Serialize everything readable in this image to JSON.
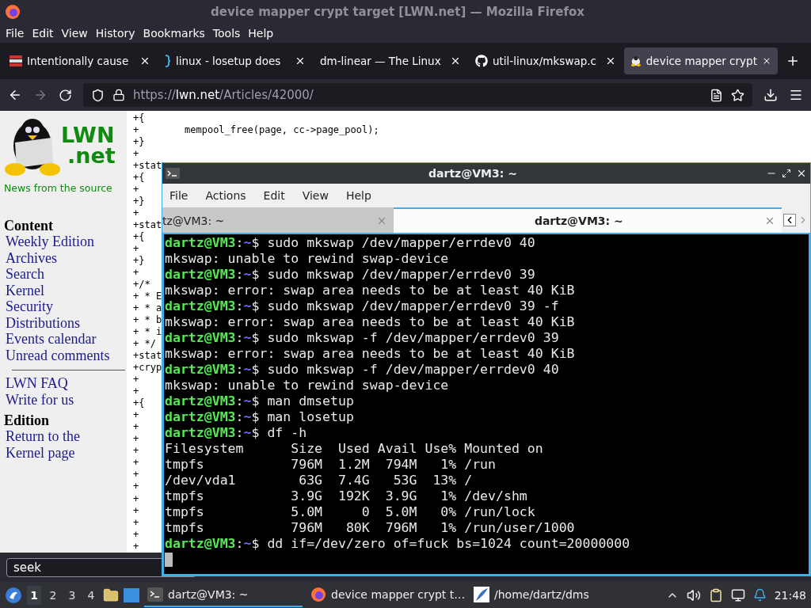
{
  "browser": {
    "title": "device mapper crypt target [LWN.net] — Mozilla Firefox",
    "menu": [
      "File",
      "Edit",
      "View",
      "History",
      "Bookmarks",
      "Tools",
      "Help"
    ],
    "tabs": [
      {
        "label": "Intentionally cause",
        "selected": false
      },
      {
        "label": "linux - losetup does",
        "selected": false
      },
      {
        "label": "dm-linear — The Linux",
        "selected": false
      },
      {
        "label": "util-linux/mkswap.c",
        "selected": false
      },
      {
        "label": "device mapper crypt",
        "selected": true
      }
    ],
    "url": {
      "scheme": "https://",
      "host": "lwn.net",
      "path": "/Articles/42000/"
    }
  },
  "sidebar": {
    "logo": {
      "line1": "LWN",
      "line2": ".net"
    },
    "tagline": "News from the source",
    "sections": [
      {
        "heading": "Content",
        "links": [
          "Weekly Edition",
          "Archives",
          "Search",
          "Kernel",
          "Security",
          "Distributions",
          "Events calendar",
          "Unread comments"
        ]
      },
      {
        "links": [
          "LWN FAQ",
          "Write for us"
        ]
      },
      {
        "heading": "Edition",
        "links": [
          "Return to the Kernel page"
        ]
      }
    ]
  },
  "code_lines": [
    "+{",
    "+        mempool_free(page, cc->page_pool);",
    "+}",
    "+",
    "+stat",
    "+{",
    "+",
    "+}",
    "+",
    "+stat",
    "+{",
    "+",
    "+}",
    "+",
    "+/*",
    "+ * E",
    "+ * a",
    "+ * b",
    "+ * i",
    "+ */",
    "+stat",
    "+cryp",
    "+",
    "+",
    "+{",
    "+",
    "+",
    "+",
    "+",
    "+",
    "+",
    "+",
    "+",
    "+",
    "+",
    "+",
    "+"
  ],
  "find_bar": {
    "value": "seek"
  },
  "terminal": {
    "title": "dartz@VM3: ~",
    "menu": [
      "File",
      "Actions",
      "Edit",
      "View",
      "Help"
    ],
    "tabs": [
      {
        "label": "tz@VM3: ~",
        "selected": false
      },
      {
        "label": "dartz@VM3: ~",
        "selected": true
      }
    ],
    "lines": [
      {
        "kind": "prompt",
        "user": "dartz@VM3",
        "colon": ":",
        "cwd": "~",
        "command": "$ sudo mkswap /dev/mapper/errdev0 40"
      },
      {
        "kind": "output",
        "text": "mkswap: unable to rewind swap-device"
      },
      {
        "kind": "prompt",
        "user": "dartz@VM3",
        "colon": ":",
        "cwd": "~",
        "command": "$ sudo mkswap /dev/mapper/errdev0 39"
      },
      {
        "kind": "output",
        "text": "mkswap: error: swap area needs to be at least 40 KiB"
      },
      {
        "kind": "prompt",
        "user": "dartz@VM3",
        "colon": ":",
        "cwd": "~",
        "command": "$ sudo mkswap /dev/mapper/errdev0 39 -f"
      },
      {
        "kind": "output",
        "text": "mkswap: error: swap area needs to be at least 40 KiB"
      },
      {
        "kind": "prompt",
        "user": "dartz@VM3",
        "colon": ":",
        "cwd": "~",
        "command": "$ sudo mkswap -f /dev/mapper/errdev0 39"
      },
      {
        "kind": "output",
        "text": "mkswap: error: swap area needs to be at least 40 KiB"
      },
      {
        "kind": "prompt",
        "user": "dartz@VM3",
        "colon": ":",
        "cwd": "~",
        "command": "$ sudo mkswap -f /dev/mapper/errdev0 40"
      },
      {
        "kind": "output",
        "text": "mkswap: unable to rewind swap-device"
      },
      {
        "kind": "prompt",
        "user": "dartz@VM3",
        "colon": ":",
        "cwd": "~",
        "command": "$ man dmsetup"
      },
      {
        "kind": "prompt",
        "user": "dartz@VM3",
        "colon": ":",
        "cwd": "~",
        "command": "$ man losetup"
      },
      {
        "kind": "prompt",
        "user": "dartz@VM3",
        "colon": ":",
        "cwd": "~",
        "command": "$ df -h"
      },
      {
        "kind": "output",
        "text": "Filesystem      Size  Used Avail Use% Mounted on"
      },
      {
        "kind": "output",
        "text": "tmpfs           796M  1.2M  794M   1% /run"
      },
      {
        "kind": "output",
        "text": "/dev/vda1        63G  7.4G   53G  13% /"
      },
      {
        "kind": "output",
        "text": "tmpfs           3.9G  192K  3.9G   1% /dev/shm"
      },
      {
        "kind": "output",
        "text": "tmpfs           5.0M     0  5.0M   0% /run/lock"
      },
      {
        "kind": "output",
        "text": "tmpfs           796M   80K  796M   1% /run/user/1000"
      },
      {
        "kind": "prompt",
        "user": "dartz@VM3",
        "colon": ":",
        "cwd": "~",
        "command": "$ dd if=/dev/zero of=fuck bs=1024 count=20000000"
      },
      {
        "kind": "cursor"
      }
    ]
  },
  "taskbar": {
    "workspaces": [
      {
        "label": "1",
        "selected": true
      },
      {
        "label": "2",
        "selected": false
      },
      {
        "label": "3",
        "selected": false
      },
      {
        "label": "4",
        "selected": false
      }
    ],
    "tasks": [
      {
        "label": "dartz@VM3: ~",
        "selected": true
      },
      {
        "label": "device mapper crypt t…",
        "selected": false
      },
      {
        "label": "/home/dartz/dms",
        "selected": false
      }
    ],
    "clock": "21:48"
  }
}
